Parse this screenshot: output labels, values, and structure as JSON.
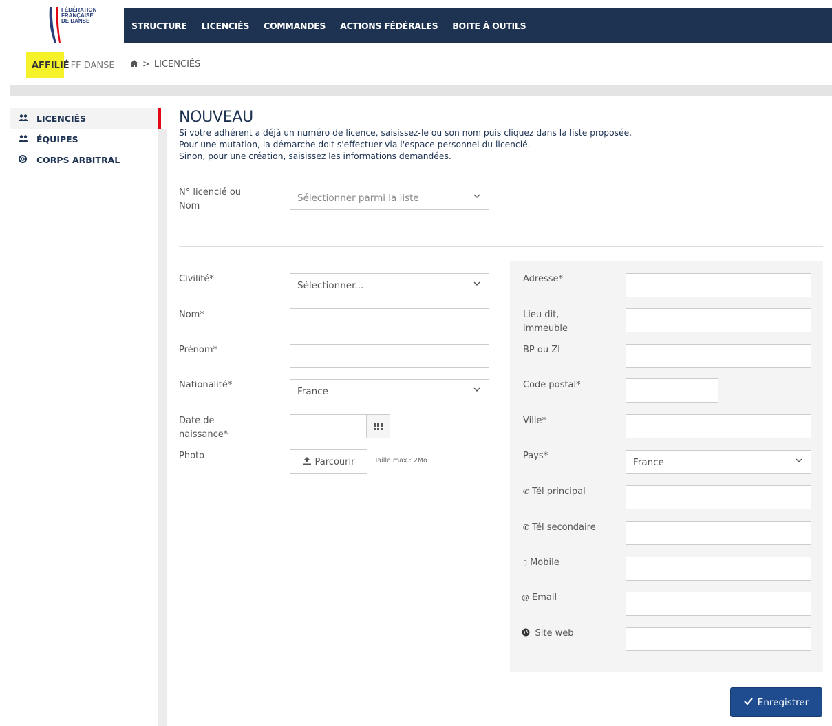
{
  "logo": {
    "line1": "FÉDÉRATION",
    "line2": "FRANÇAISE",
    "line3": "DE DANSE"
  },
  "nav": {
    "items": [
      "STRUCTURE",
      "LICENCIÉS",
      "COMMANDES",
      "ACTIONS FÉDÉRALES",
      "BOITE À OUTILS"
    ]
  },
  "subheader": {
    "affil_label": "AFFILIÉ",
    "org": "FF DANSE",
    "breadcrumb_sep": ">",
    "breadcrumb_current": "LICENCIÉS"
  },
  "sidebar": {
    "items": [
      {
        "label": "LICENCIÉS",
        "icon": "users-icon",
        "active": true
      },
      {
        "label": "ÉQUIPES",
        "icon": "users-icon",
        "active": false
      },
      {
        "label": "CORPS ARBITRAL",
        "icon": "life-ring-icon",
        "active": false
      }
    ]
  },
  "main": {
    "title": "NOUVEAU",
    "info": [
      "Si votre adhérent a déjà un numéro de licence, saisissez-le ou son nom puis cliquez dans la liste proposée.",
      "Pour une mutation, la démarche doit s'effectuer via l'espace personnel du licencié.",
      "Sinon, pour une création, saisissez les informations demandées."
    ],
    "search": {
      "label_line1": "N° licencié ou",
      "label_line2": "Nom",
      "placeholder": "Sélectionner parmi la liste"
    }
  },
  "left_form": {
    "civilite": {
      "label": "Civilité*",
      "value": "Sélectionner..."
    },
    "nom": {
      "label": "Nom*",
      "value": ""
    },
    "prenom": {
      "label": "Prénom*",
      "value": ""
    },
    "nationalite": {
      "label": "Nationalité*",
      "value": "France"
    },
    "naissance": {
      "label_line1": "Date de",
      "label_line2": "naissance*",
      "value": ""
    },
    "photo": {
      "label": "Photo",
      "button": "Parcourir",
      "hint": "Taille max.: 2Mo"
    }
  },
  "right_form": {
    "adresse": {
      "label": "Adresse*",
      "value": ""
    },
    "lieu": {
      "label_line1": "Lieu dit,",
      "label_line2": "immeuble",
      "value": ""
    },
    "bp": {
      "label": "BP ou ZI",
      "value": ""
    },
    "cp": {
      "label": "Code postal*",
      "value": ""
    },
    "ville": {
      "label": "Ville*",
      "value": ""
    },
    "pays": {
      "label": "Pays*",
      "value": "France"
    },
    "tel1": {
      "label": "Tél principal",
      "icon": "phone-icon",
      "value": ""
    },
    "tel2": {
      "label": "Tél secondaire",
      "icon": "phone-icon",
      "value": ""
    },
    "mobile": {
      "label": "Mobile",
      "icon": "mobile-icon",
      "value": ""
    },
    "email": {
      "label": "Email",
      "icon": "at-icon",
      "value": ""
    },
    "web": {
      "label": "Site web",
      "icon": "globe-icon",
      "value": ""
    }
  },
  "actions": {
    "save": "Enregistrer"
  },
  "colors": {
    "navy": "#1e3352",
    "accent_red": "#e30613",
    "highlight": "#f5f22a",
    "button_blue": "#1f4c8f"
  }
}
